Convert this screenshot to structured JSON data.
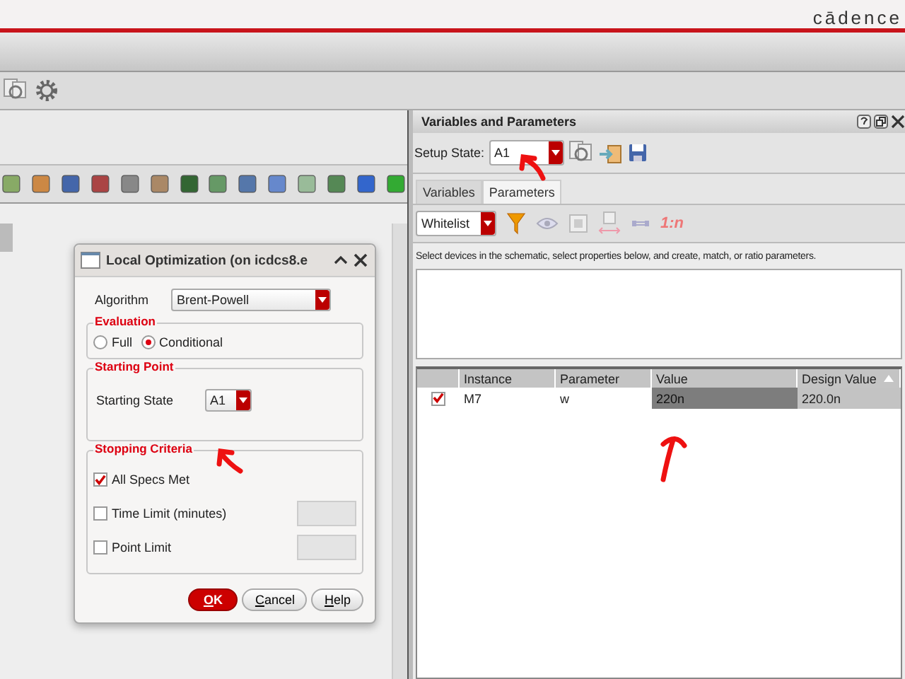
{
  "app": {
    "logo": "cādence"
  },
  "variables_panel": {
    "title": "Variables and Parameters",
    "setup_state": {
      "label": "Setup State:",
      "value": "A1"
    },
    "tabs": [
      {
        "label": "Variables",
        "selected": false
      },
      {
        "label": "Parameters",
        "selected": true
      }
    ],
    "filter": {
      "value": "Whitelist"
    },
    "ratio_label": "1:n",
    "description": "Select devices in the schematic, select properties below, and create, match, or ratio parameters.",
    "table": {
      "columns": [
        "Instance",
        "Parameter",
        "Value",
        "Design Value"
      ],
      "rows": [
        {
          "checked": true,
          "instance": "M7",
          "parameter": "w",
          "value": "220n",
          "design_value": "220.0n"
        }
      ]
    }
  },
  "dialog": {
    "title": "Local Optimization (on icdcs8.e",
    "algorithm": {
      "label": "Algorithm",
      "value": "Brent-Powell"
    },
    "evaluation": {
      "title": "Evaluation",
      "options": [
        {
          "label": "Full",
          "selected": false
        },
        {
          "label": "Conditional",
          "selected": true
        }
      ]
    },
    "starting_point": {
      "title": "Starting Point",
      "label": "Starting State",
      "value": "A1"
    },
    "stopping_criteria": {
      "title": "Stopping Criteria",
      "items": [
        {
          "label": "All Specs Met",
          "checked": true,
          "kind": "check"
        },
        {
          "label": "Time Limit (minutes)",
          "checked": false,
          "kind": "check_field"
        },
        {
          "label": "Point Limit",
          "checked": false,
          "kind": "check_field"
        }
      ]
    },
    "buttons": [
      {
        "label": "OK",
        "kind": "primary"
      },
      {
        "label": "Cancel",
        "kind": "normal"
      },
      {
        "label": "Help",
        "kind": "normal"
      }
    ]
  }
}
